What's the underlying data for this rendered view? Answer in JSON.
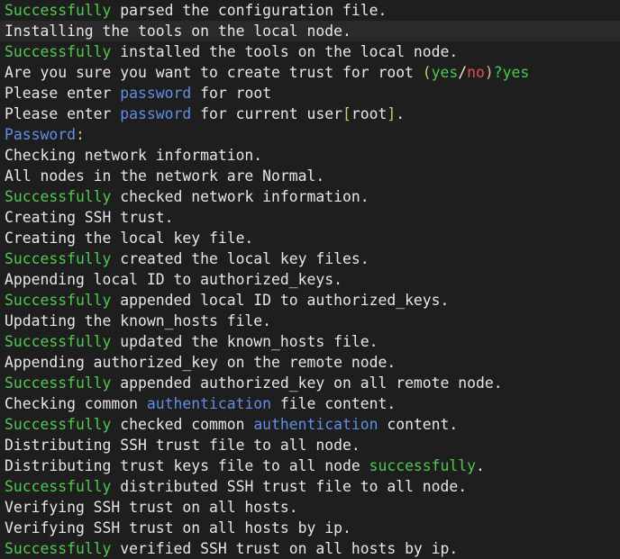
{
  "colors": {
    "background": "#1e1e1e",
    "text": "#e6e6e6",
    "success_green": "#4ec94e",
    "keyword_blue": "#5f8fe8",
    "paren_yellow": "#d7c07a",
    "no_red": "#e05050",
    "highlight_row": "#2a2a2a"
  },
  "terminal": {
    "lines": [
      {
        "highlight": false,
        "segments": [
          {
            "t": "Successfully",
            "c": "green"
          },
          {
            "t": " parsed the configuration file.",
            "c": "white"
          }
        ]
      },
      {
        "highlight": true,
        "segments": [
          {
            "t": "Installing the tools on the local node.",
            "c": "white"
          }
        ]
      },
      {
        "highlight": false,
        "segments": [
          {
            "t": "Successfully",
            "c": "green"
          },
          {
            "t": " installed the tools on the local node.",
            "c": "white"
          }
        ]
      },
      {
        "highlight": false,
        "segments": [
          {
            "t": "Are you sure you want to create trust for root ",
            "c": "white"
          },
          {
            "t": "(",
            "c": "yellow"
          },
          {
            "t": "yes",
            "c": "green"
          },
          {
            "t": "/",
            "c": "white"
          },
          {
            "t": "no",
            "c": "red"
          },
          {
            "t": ")",
            "c": "yellow"
          },
          {
            "t": "?yes",
            "c": "green"
          }
        ]
      },
      {
        "highlight": false,
        "segments": [
          {
            "t": "Please enter ",
            "c": "white"
          },
          {
            "t": "password",
            "c": "blue"
          },
          {
            "t": " for root",
            "c": "white"
          }
        ]
      },
      {
        "highlight": false,
        "segments": [
          {
            "t": "Please enter ",
            "c": "white"
          },
          {
            "t": "password",
            "c": "blue"
          },
          {
            "t": " for current user",
            "c": "white"
          },
          {
            "t": "[",
            "c": "yellow"
          },
          {
            "t": "root",
            "c": "white"
          },
          {
            "t": "]",
            "c": "yellow"
          },
          {
            "t": ".",
            "c": "white"
          }
        ]
      },
      {
        "highlight": false,
        "segments": [
          {
            "t": "Password",
            "c": "blue"
          },
          {
            "t": ":",
            "c": "yellow"
          }
        ]
      },
      {
        "highlight": false,
        "segments": [
          {
            "t": "Checking network information.",
            "c": "white"
          }
        ]
      },
      {
        "highlight": false,
        "segments": [
          {
            "t": "All nodes in the network are Normal.",
            "c": "white"
          }
        ]
      },
      {
        "highlight": false,
        "segments": [
          {
            "t": "Successfully",
            "c": "green"
          },
          {
            "t": " checked network information.",
            "c": "white"
          }
        ]
      },
      {
        "highlight": false,
        "segments": [
          {
            "t": "Creating SSH trust.",
            "c": "white"
          }
        ]
      },
      {
        "highlight": false,
        "segments": [
          {
            "t": "Creating the local key file.",
            "c": "white"
          }
        ]
      },
      {
        "highlight": false,
        "segments": [
          {
            "t": "Successfully",
            "c": "green"
          },
          {
            "t": " created the local key files.",
            "c": "white"
          }
        ]
      },
      {
        "highlight": false,
        "segments": [
          {
            "t": "Appending local ID to authorized_keys.",
            "c": "white"
          }
        ]
      },
      {
        "highlight": false,
        "segments": [
          {
            "t": "Successfully",
            "c": "green"
          },
          {
            "t": " appended local ID to authorized_keys.",
            "c": "white"
          }
        ]
      },
      {
        "highlight": false,
        "segments": [
          {
            "t": "Updating the known_hosts file.",
            "c": "white"
          }
        ]
      },
      {
        "highlight": false,
        "segments": [
          {
            "t": "Successfully",
            "c": "green"
          },
          {
            "t": " updated the known_hosts file.",
            "c": "white"
          }
        ]
      },
      {
        "highlight": false,
        "segments": [
          {
            "t": "Appending authorized_key on the remote node.",
            "c": "white"
          }
        ]
      },
      {
        "highlight": false,
        "segments": [
          {
            "t": "Successfully",
            "c": "green"
          },
          {
            "t": " appended authorized_key on all remote node.",
            "c": "white"
          }
        ]
      },
      {
        "highlight": false,
        "segments": [
          {
            "t": "Checking common ",
            "c": "white"
          },
          {
            "t": "authentication",
            "c": "blue"
          },
          {
            "t": " file content.",
            "c": "white"
          }
        ]
      },
      {
        "highlight": false,
        "segments": [
          {
            "t": "Successfully",
            "c": "green"
          },
          {
            "t": " checked common ",
            "c": "white"
          },
          {
            "t": "authentication",
            "c": "blue"
          },
          {
            "t": " content.",
            "c": "white"
          }
        ]
      },
      {
        "highlight": false,
        "segments": [
          {
            "t": "Distributing SSH trust file to all node.",
            "c": "white"
          }
        ]
      },
      {
        "highlight": false,
        "segments": [
          {
            "t": "Distributing trust keys file to all node ",
            "c": "white"
          },
          {
            "t": "successfully",
            "c": "green"
          },
          {
            "t": ".",
            "c": "white"
          }
        ]
      },
      {
        "highlight": false,
        "segments": [
          {
            "t": "Successfully",
            "c": "green"
          },
          {
            "t": " distributed SSH trust file to all node.",
            "c": "white"
          }
        ]
      },
      {
        "highlight": false,
        "segments": [
          {
            "t": "Verifying SSH trust on all hosts.",
            "c": "white"
          }
        ]
      },
      {
        "highlight": false,
        "segments": [
          {
            "t": "Verifying SSH trust on all hosts by ip.",
            "c": "white"
          }
        ]
      },
      {
        "highlight": false,
        "segments": [
          {
            "t": "Successfully",
            "c": "green"
          },
          {
            "t": " verified SSH trust on all hosts by ip.",
            "c": "white"
          }
        ]
      }
    ]
  }
}
